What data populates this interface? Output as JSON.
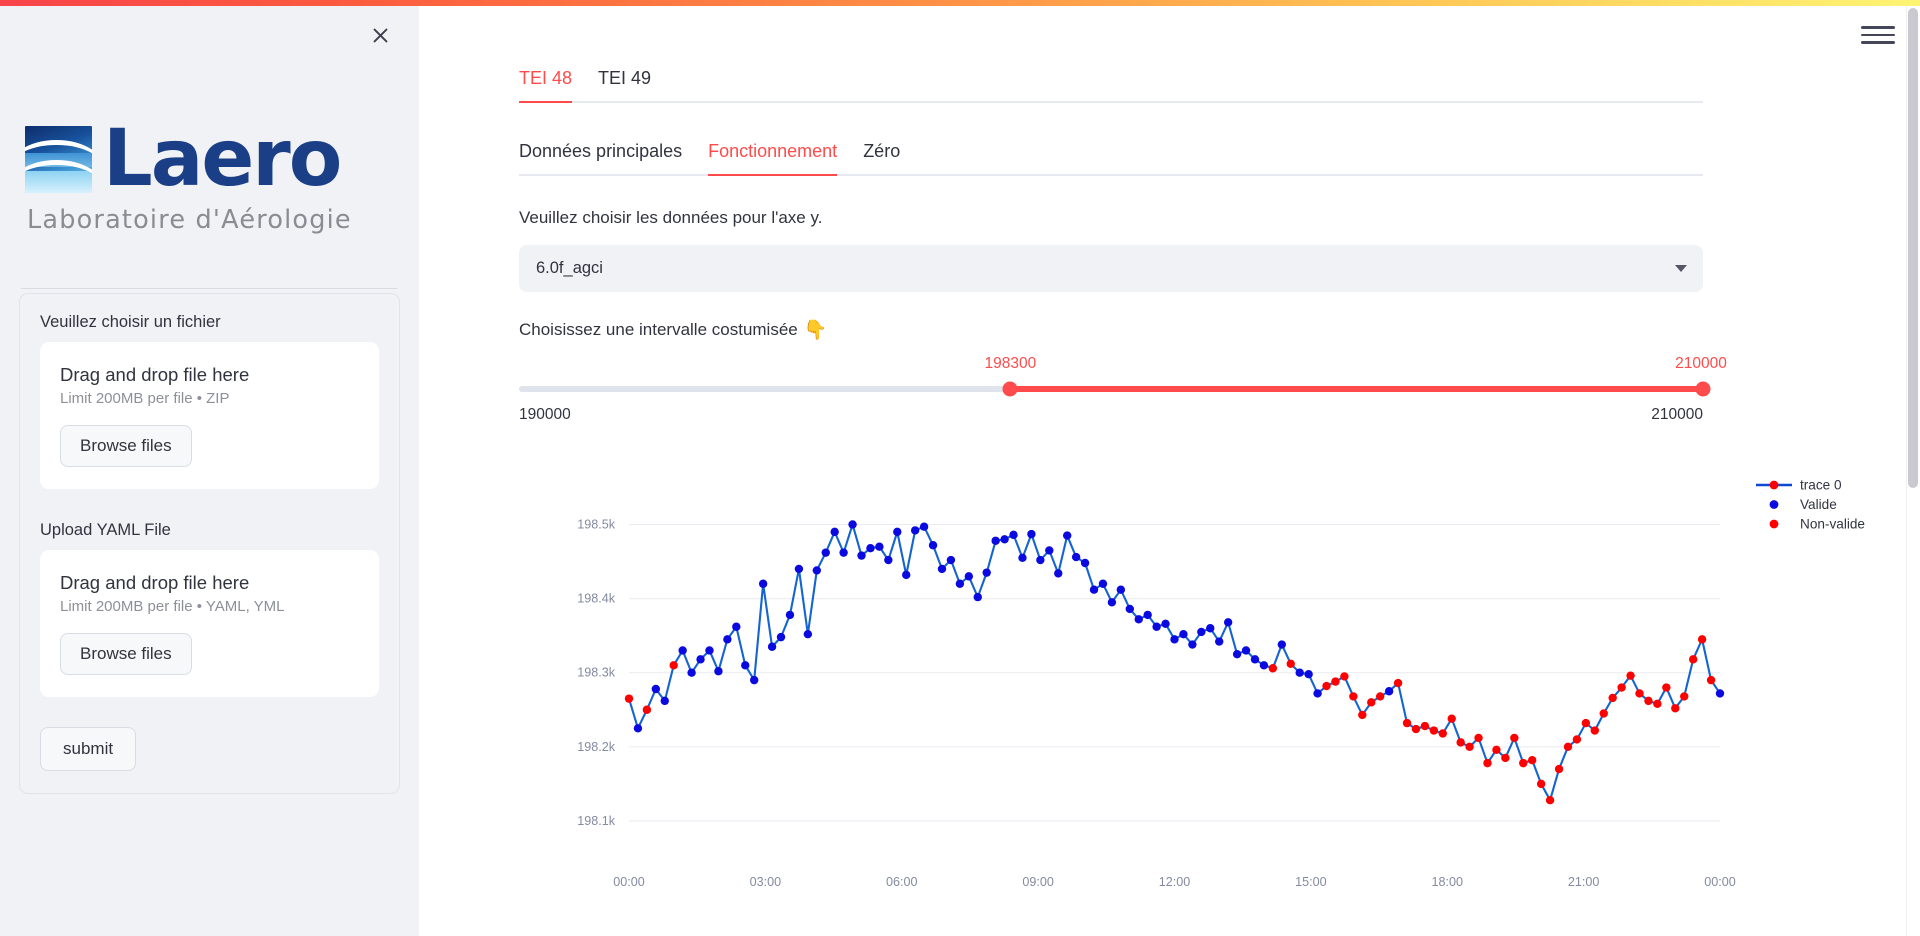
{
  "window": {
    "close_label": "×",
    "menu_label": "menu"
  },
  "sidebar": {
    "logo": {
      "wordmark": "Laero",
      "tagline": "Laboratoire d'Aérologie"
    },
    "form": {
      "file_label": "Veuillez choisir un fichier",
      "dropzone_zip": {
        "title": "Drag and drop file here",
        "limit": "Limit 200MB per file • ZIP",
        "browse_label": "Browse files"
      },
      "yaml_label": "Upload YAML File",
      "dropzone_yaml": {
        "title": "Drag and drop file here",
        "limit": "Limit 200MB per file • YAML, YML",
        "browse_label": "Browse files"
      },
      "submit_label": "submit"
    }
  },
  "main": {
    "top_tabs": [
      {
        "label": "TEI 48",
        "active": true
      },
      {
        "label": "TEI 49",
        "active": false
      }
    ],
    "sub_tabs": [
      {
        "label": "Données principales",
        "active": false
      },
      {
        "label": "Fonctionnement",
        "active": true
      },
      {
        "label": "Zéro",
        "active": false
      }
    ],
    "y_axis_prompt": "Veuillez choisir les données pour l'axe y.",
    "y_axis_selected": "6.0f_agci",
    "interval_prompt": "Choisissez une intervalle costumisée",
    "interval_icon": "👇",
    "slider": {
      "min_label": "190000",
      "max_label": "210000",
      "min_value": 190000,
      "max_value": 210000,
      "low_value": 198300,
      "high_value": 210000,
      "low_label": "198300",
      "high_label": "210000",
      "accent_color": "#ff4b4b"
    }
  },
  "chart_data": {
    "type": "line",
    "title": "",
    "xlabel": "",
    "ylabel": "",
    "x_ticks": [
      "00:00",
      "03:00",
      "06:00",
      "09:00",
      "12:00",
      "15:00",
      "18:00",
      "21:00",
      "00:00"
    ],
    "y_ticks": [
      "198.1k",
      "198.2k",
      "198.3k",
      "198.4k",
      "198.5k"
    ],
    "y_tick_values": [
      198100,
      198200,
      198300,
      198400,
      198500
    ],
    "ylim": [
      198050,
      198560
    ],
    "xlim": [
      0,
      144
    ],
    "grid": true,
    "legend_position": "right",
    "legend": [
      {
        "name": "trace 0",
        "type": "line-marker",
        "line_color": "#0a49d6",
        "marker_color": "#ff0000"
      },
      {
        "name": "Valide",
        "type": "marker",
        "marker_color": "#0a0ae0"
      },
      {
        "name": "Non-valide",
        "type": "marker",
        "marker_color": "#ff0000"
      }
    ],
    "line_color": "#1464d2",
    "series": [
      {
        "name": "trace 0",
        "values": [
          198265,
          198225,
          198250,
          198278,
          198262,
          198310,
          198330,
          198300,
          198318,
          198330,
          198302,
          198345,
          198362,
          198310,
          198290,
          198420,
          198335,
          198348,
          198378,
          198440,
          198352,
          198438,
          198462,
          198490,
          198462,
          198500,
          198458,
          198468,
          198470,
          198452,
          198490,
          198432,
          198492,
          198497,
          198472,
          198440,
          198452,
          198420,
          198430,
          198402,
          198435,
          198478,
          198480,
          198486,
          198455,
          198487,
          198452,
          198465,
          198434,
          198485,
          198456,
          198448,
          198412,
          198420,
          198395,
          198412,
          198386,
          198372,
          198378,
          198362,
          198366,
          198345,
          198352,
          198338,
          198355,
          198360,
          198342,
          198368,
          198325,
          198330,
          198318,
          198310,
          198306,
          198338,
          198312,
          198300,
          198298,
          198272,
          198282,
          198288,
          198295,
          198268,
          198243,
          198260,
          198268,
          198275,
          198286,
          198232,
          198224,
          198228,
          198222,
          198218,
          198238,
          198206,
          198200,
          198212,
          198178,
          198196,
          198185,
          198212,
          198178,
          198182,
          198150,
          198128,
          198170,
          198200,
          198210,
          198232,
          198222,
          198245,
          198266,
          198280,
          198296,
          198272,
          198262,
          198258,
          198280,
          198252,
          198268,
          198318,
          198345,
          198290,
          198272
        ]
      }
    ],
    "marker_states": [
      "non-valide",
      "valide",
      "non-valide",
      "valide",
      "valide",
      "non-valide",
      "valide",
      "valide",
      "valide",
      "valide",
      "valide",
      "valide",
      "valide",
      "valide",
      "valide",
      "valide",
      "valide",
      "valide",
      "valide",
      "valide",
      "valide",
      "valide",
      "valide",
      "valide",
      "valide",
      "valide",
      "valide",
      "valide",
      "valide",
      "valide",
      "valide",
      "valide",
      "valide",
      "valide",
      "valide",
      "valide",
      "valide",
      "valide",
      "valide",
      "valide",
      "valide",
      "valide",
      "valide",
      "valide",
      "valide",
      "valide",
      "valide",
      "valide",
      "valide",
      "valide",
      "valide",
      "valide",
      "valide",
      "valide",
      "valide",
      "valide",
      "valide",
      "valide",
      "valide",
      "valide",
      "valide",
      "valide",
      "valide",
      "valide",
      "valide",
      "valide",
      "valide",
      "valide",
      "valide",
      "valide",
      "valide",
      "valide",
      "non-valide",
      "valide",
      "non-valide",
      "valide",
      "valide",
      "valide",
      "non-valide",
      "non-valide",
      "non-valide",
      "non-valide",
      "non-valide",
      "non-valide",
      "non-valide",
      "valide",
      "non-valide",
      "non-valide",
      "non-valide",
      "non-valide",
      "non-valide",
      "non-valide",
      "non-valide",
      "non-valide",
      "non-valide",
      "non-valide",
      "non-valide",
      "non-valide",
      "non-valide",
      "non-valide",
      "non-valide",
      "non-valide",
      "non-valide",
      "non-valide",
      "non-valide",
      "non-valide",
      "non-valide",
      "non-valide",
      "non-valide",
      "non-valide",
      "non-valide",
      "non-valide",
      "non-valide",
      "non-valide",
      "non-valide",
      "non-valide",
      "non-valide",
      "non-valide",
      "non-valide",
      "non-valide",
      "non-valide",
      "non-valide"
    ]
  }
}
